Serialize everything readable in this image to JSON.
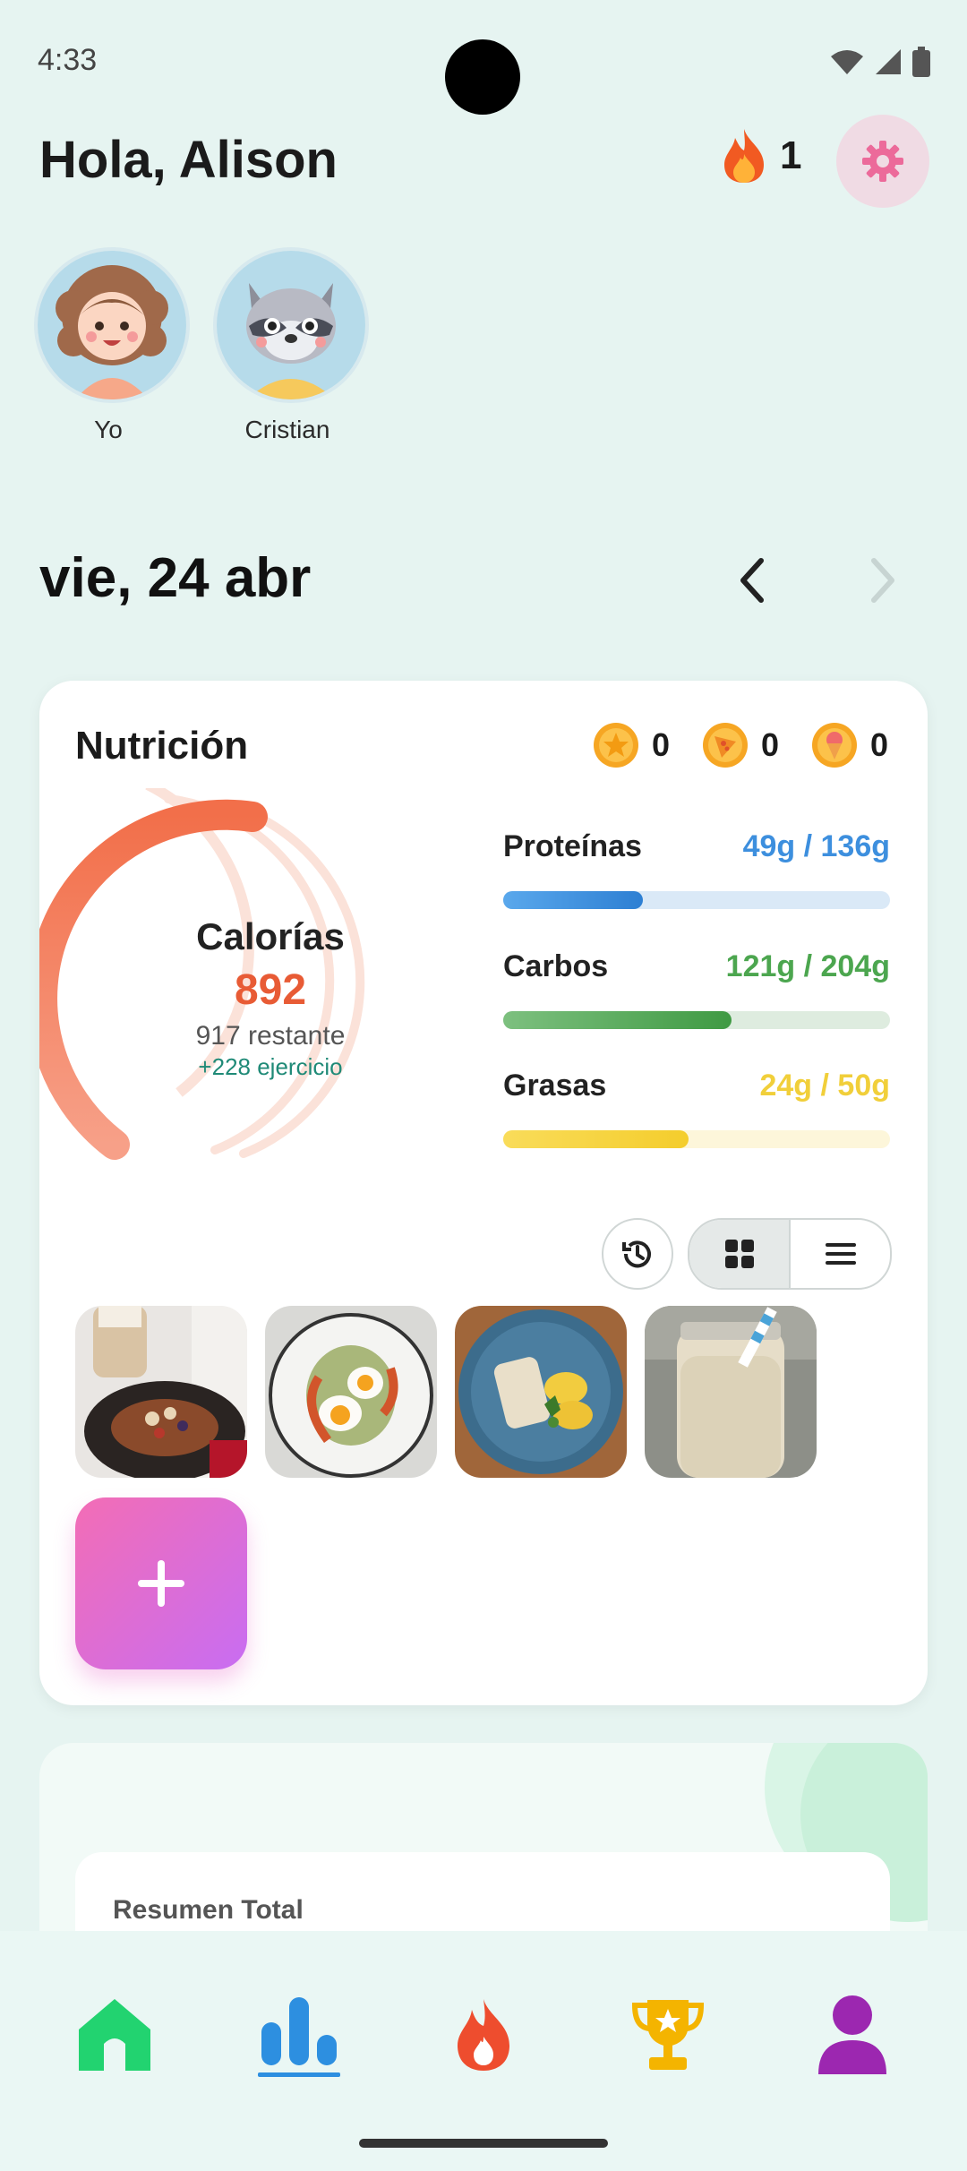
{
  "status_bar": {
    "time": "4:33",
    "icons": [
      "wifi-icon",
      "signal-icon",
      "battery-icon"
    ]
  },
  "header": {
    "greeting": "Hola, Alison",
    "streak_count": "1",
    "streak_icon": "fire-icon",
    "settings_icon": "gear-icon"
  },
  "profiles": [
    {
      "name": "Yo",
      "avatar": "girl-avatar"
    },
    {
      "name": "Cristian",
      "avatar": "raccoon-avatar"
    }
  ],
  "date_nav": {
    "date": "vie, 24 abr",
    "prev_icon": "chevron-left-icon",
    "next_icon": "chevron-right-icon"
  },
  "nutrition": {
    "title": "Nutrición",
    "badges": [
      {
        "icon": "star-coin-icon",
        "count": "0"
      },
      {
        "icon": "pizza-coin-icon",
        "count": "0"
      },
      {
        "icon": "ice-cream-coin-icon",
        "count": "0"
      }
    ],
    "calories": {
      "label": "Calorías",
      "value": "892",
      "remaining": "917 restante",
      "exercise": "+228 ejercicio",
      "progress": 0.37
    },
    "macros": [
      {
        "label": "Proteínas",
        "value": "49g / 136g",
        "progress": 0.36,
        "color": "#3d8fde",
        "track": "#dae9f7"
      },
      {
        "label": "Carbos",
        "value": "121g / 204g",
        "progress": 0.59,
        "color": "#4ca64f",
        "track": "#deecdf"
      },
      {
        "label": "Grasas",
        "value": "24g / 50g",
        "progress": 0.48,
        "color": "#f4d23c",
        "track": "#fdf6da"
      }
    ],
    "view_controls": {
      "history_icon": "history-icon",
      "grid_icon": "grid-icon",
      "list_icon": "list-icon"
    },
    "meals": [
      {
        "name": "french-toast-meal"
      },
      {
        "name": "eggs-avocado-meal"
      },
      {
        "name": "fish-potatoes-meal"
      },
      {
        "name": "smoothie-meal"
      }
    ],
    "add_icon": "plus-icon"
  },
  "summary": {
    "title": "Resumen Total"
  },
  "bottom_nav": [
    {
      "name": "nav-home",
      "icon": "home-icon",
      "color": "#22d370"
    },
    {
      "name": "nav-stats",
      "icon": "bar-chart-icon",
      "color": "#2d8fe0"
    },
    {
      "name": "nav-streak",
      "icon": "fire-icon",
      "color": "#ee4d2e"
    },
    {
      "name": "nav-trophy",
      "icon": "trophy-icon",
      "color": "#f4b400"
    },
    {
      "name": "nav-profile",
      "icon": "user-icon",
      "color": "#9c27b0"
    }
  ],
  "colors": {
    "background": "#e6f4f1",
    "accent_calories": "#f2724a",
    "settings_accent": "#ec6a9a"
  }
}
